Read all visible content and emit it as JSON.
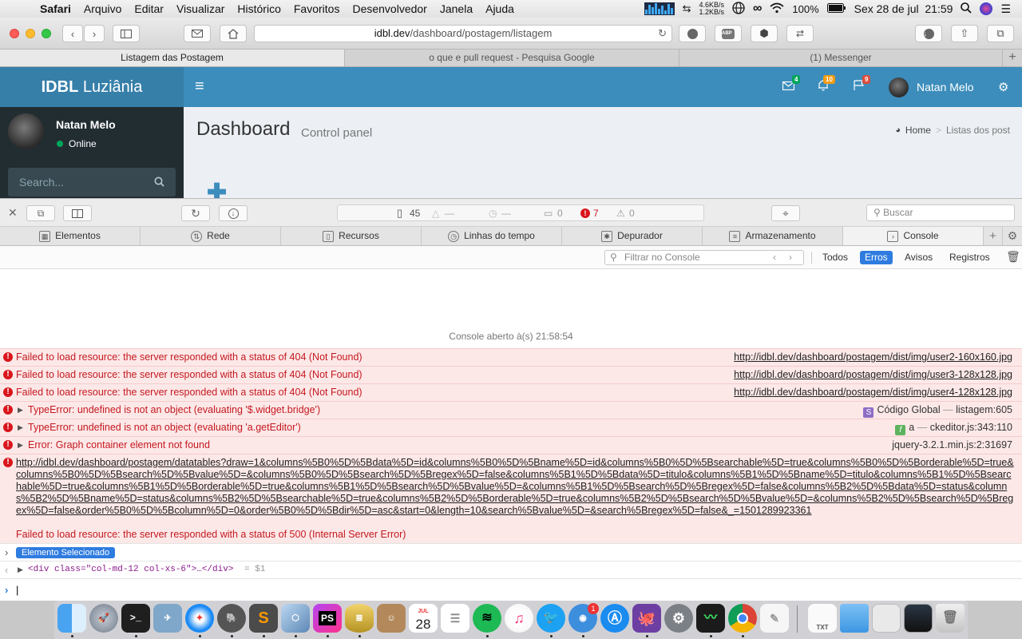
{
  "menubar": {
    "app": "Safari",
    "items": [
      "Arquivo",
      "Editar",
      "Visualizar",
      "Histórico",
      "Favoritos",
      "Desenvolvedor",
      "Janela",
      "Ajuda"
    ],
    "net_up": "4.6KB/s",
    "net_down": "1.2KB/s",
    "battery": "100%",
    "datetime": "Sex 28 de jul  21:59"
  },
  "browser": {
    "url_prefix": "idbl.dev",
    "url_path": "/dashboard/postagem/listagem",
    "tabs": [
      {
        "title": "Listagem das Postagem",
        "active": true
      },
      {
        "title": "o que e pull request - Pesquisa Google",
        "active": false
      },
      {
        "title": "(1) Messenger",
        "active": false
      }
    ],
    "add_tab": "+"
  },
  "app": {
    "logo_bold": "IDBL",
    "logo_rest": " Luziânia",
    "menu_toggle": "≡",
    "badges": {
      "mail": "4",
      "bell": "10",
      "flag": "9"
    },
    "user_name": "Natan Melo",
    "sidebar_user": "Natan Melo",
    "sidebar_status": "Online",
    "search_placeholder": "Search...",
    "title": "Dashboard",
    "subtitle": "Control panel",
    "breadcrumb": {
      "home": "Home",
      "sep": ">",
      "current": "Listas dos post"
    }
  },
  "devtools": {
    "stats": {
      "resources": "45",
      "dash1": "—",
      "dash2": "—",
      "logs": "0",
      "errors": "7",
      "warnings": "0"
    },
    "search_placeholder": "Buscar",
    "tabs": [
      "Elementos",
      "Rede",
      "Recursos",
      "Linhas do tempo",
      "Depurador",
      "Armazenamento",
      "Console"
    ],
    "active_tab": "Console",
    "filter_placeholder": "Filtrar no Console",
    "filters": [
      "Todos",
      "Erros",
      "Avisos",
      "Registros"
    ],
    "active_filter": "Erros",
    "console_opened": "Console aberto à(s) 21:58:54",
    "messages": [
      {
        "text": "Failed to load resource: the server responded with a status of 404 (Not Found)",
        "source": "http://idbl.dev/dashboard/postagem/dist/img/user2-160x160.jpg"
      },
      {
        "text": "Failed to load resource: the server responded with a status of 404 (Not Found)",
        "source": "http://idbl.dev/dashboard/postagem/dist/img/user3-128x128.jpg"
      },
      {
        "text": "Failed to load resource: the server responded with a status of 404 (Not Found)",
        "source": "http://idbl.dev/dashboard/postagem/dist/img/user4-128x128.jpg"
      },
      {
        "text": "TypeError: undefined is not an object (evaluating '$.widget.bridge')",
        "source_tag": "S",
        "source_name": "Código Global",
        "source_sep": "—",
        "source_file": "listagem:605"
      },
      {
        "text": "TypeError: undefined is not an object (evaluating 'a.getEditor')",
        "source_tag": "f",
        "source_name": "a",
        "source_sep": "—",
        "source_file": "ckeditor.js:343:110"
      },
      {
        "text": "Error: Graph container element not found",
        "source_file": "jquery-3.2.1.min.js:2:31697"
      }
    ],
    "long_error": {
      "url": "http://idbl.dev/dashboard/postagem/datatables?draw=1&columns%5B0%5D%5Bdata%5D=id&columns%5B0%5D%5Bname%5D=id&columns%5B0%5D%5Bsearchable%5D=true&columns%5B0%5D%5Borderable%5D=true&columns%5B0%5D%5Bsearch%5D%5Bvalue%5D=&columns%5B0%5D%5Bsearch%5D%5Bregex%5D=false&columns%5B1%5D%5Bdata%5D=titulo&columns%5B1%5D%5Bname%5D=titulo&columns%5B1%5D%5Bsearchable%5D=true&columns%5B1%5D%5Borderable%5D=true&columns%5B1%5D%5Bsearch%5D%5Bvalue%5D=&columns%5B1%5D%5Bsearch%5D%5Bregex%5D=false&columns%5B2%5D%5Bdata%5D=status&columns%5B2%5D%5Bname%5D=status&columns%5B2%5D%5Bsearchable%5D=true&columns%5B2%5D%5Borderable%5D=true&columns%5B2%5D%5Bsearch%5D%5Bvalue%5D=&columns%5B2%5D%5Bsearch%5D%5Bregex%5D=false&order%5B0%5D%5Bcolumn%5D=0&order%5B0%5D%5Bdir%5D=asc&start=0&length=10&search%5Bvalue%5D=&search%5Bregex%5D=false&_=1501289923361",
      "text": "Failed to load resource: the server responded with a status of 500 (Internal Server Error)"
    },
    "selected_label": "Elemento Selecionado",
    "selected_node": "<div class=\"col-md-12 col-xs-6\">…</div>",
    "selected_var": "= $1",
    "prompt": "|"
  },
  "dock": {
    "calendar_month": "JUL",
    "calendar_day": "28",
    "ps_label": "PS",
    "app_store_badge": "1",
    "textedit_label": "TXT"
  }
}
